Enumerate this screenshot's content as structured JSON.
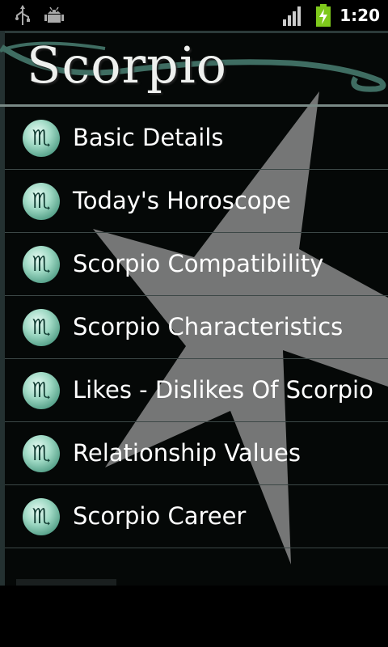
{
  "status_bar": {
    "time": "1:20",
    "icons": [
      "usb-icon",
      "android-debug-icon",
      "signal-icon",
      "battery-charging-icon"
    ]
  },
  "header": {
    "title": "Scorpio"
  },
  "menu": {
    "icon": "scorpio-glyph-icon",
    "items": [
      {
        "label": "Basic Details"
      },
      {
        "label": "Today's Horoscope"
      },
      {
        "label": "Scorpio Compatibility"
      },
      {
        "label": "Scorpio Characteristics"
      },
      {
        "label": "Likes - Dislikes Of Scorpio"
      },
      {
        "label": "Relationship Values"
      },
      {
        "label": "Scorpio Career"
      }
    ]
  },
  "colors": {
    "background": "#000000",
    "accent_teal": "#4e9b83",
    "text": "#ffffff"
  }
}
